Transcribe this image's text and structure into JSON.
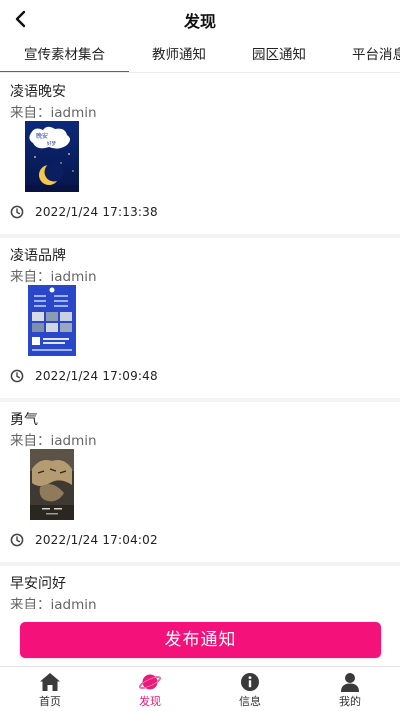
{
  "header": {
    "title": "发现",
    "back_icon": "chevron-left-icon"
  },
  "tabs": [
    {
      "label": "宣传素材集合",
      "active": true
    },
    {
      "label": "教师通知",
      "active": false
    },
    {
      "label": "园区通知",
      "active": false
    },
    {
      "label": "平台消息",
      "active": false
    }
  ],
  "feed": {
    "items": [
      {
        "title": "凌语晚安",
        "from": "来自：iadmin",
        "time": "2022/1/24 17:13:38",
        "thumb": "goodnight-moon-poster"
      },
      {
        "title": "凌语品牌",
        "from": "来自：iadmin",
        "time": "2022/1/24 17:09:48",
        "thumb": "brand-blue-poster"
      },
      {
        "title": "勇气",
        "from": "来自：iadmin",
        "time": "2022/1/24 17:04:02",
        "thumb": "courage-tiger-poster"
      },
      {
        "title": "早安问好",
        "from": "来自：iadmin",
        "time": "",
        "thumb": ""
      }
    ]
  },
  "actions": {
    "publish_label": "发布通知"
  },
  "bottom_nav": [
    {
      "label": "首页",
      "icon": "home-icon",
      "active": false
    },
    {
      "label": "发现",
      "icon": "planet-icon",
      "active": true
    },
    {
      "label": "信息",
      "icon": "info-icon",
      "active": false
    },
    {
      "label": "我的",
      "icon": "user-icon",
      "active": false
    }
  ],
  "colors": {
    "accent": "#ea1a7b",
    "button": "#f5117a",
    "feed_bg": "#f3f3f3"
  }
}
